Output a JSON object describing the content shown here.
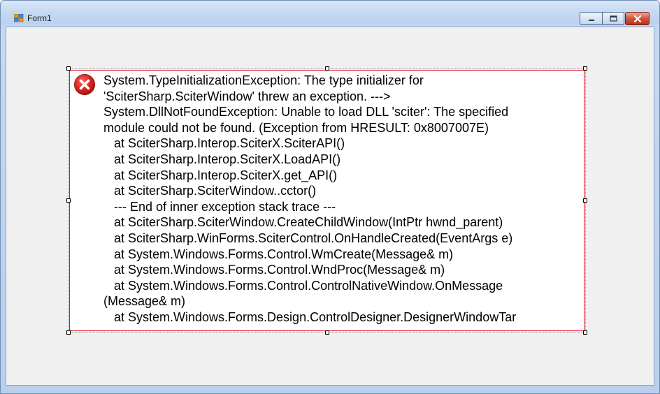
{
  "window": {
    "title": "Form1"
  },
  "error_panel": {
    "icon": "error-icon",
    "lines": [
      "System.TypeInitializationException: The type initializer for",
      "'SciterSharp.SciterWindow' threw an exception. --->",
      "System.DllNotFoundException: Unable to load DLL 'sciter': The specified",
      "module could not be found. (Exception from HRESULT: 0x8007007E)",
      "   at SciterSharp.Interop.SciterX.SciterAPI()",
      "   at SciterSharp.Interop.SciterX.LoadAPI()",
      "   at SciterSharp.Interop.SciterX.get_API()",
      "   at SciterSharp.SciterWindow..cctor()",
      "   --- End of inner exception stack trace ---",
      "   at SciterSharp.SciterWindow.CreateChildWindow(IntPtr hwnd_parent)",
      "   at SciterSharp.WinForms.SciterControl.OnHandleCreated(EventArgs e)",
      "   at System.Windows.Forms.Control.WmCreate(Message& m)",
      "   at System.Windows.Forms.Control.WndProc(Message& m)",
      "   at System.Windows.Forms.Control.ControlNativeWindow.OnMessage",
      "(Message& m)",
      "   at System.Windows.Forms.Design.ControlDesigner.DesignerWindowTar"
    ]
  },
  "colors": {
    "error_border": "#e81123",
    "error_icon": "#d9211f",
    "client_bg": "#f0f0f0"
  }
}
